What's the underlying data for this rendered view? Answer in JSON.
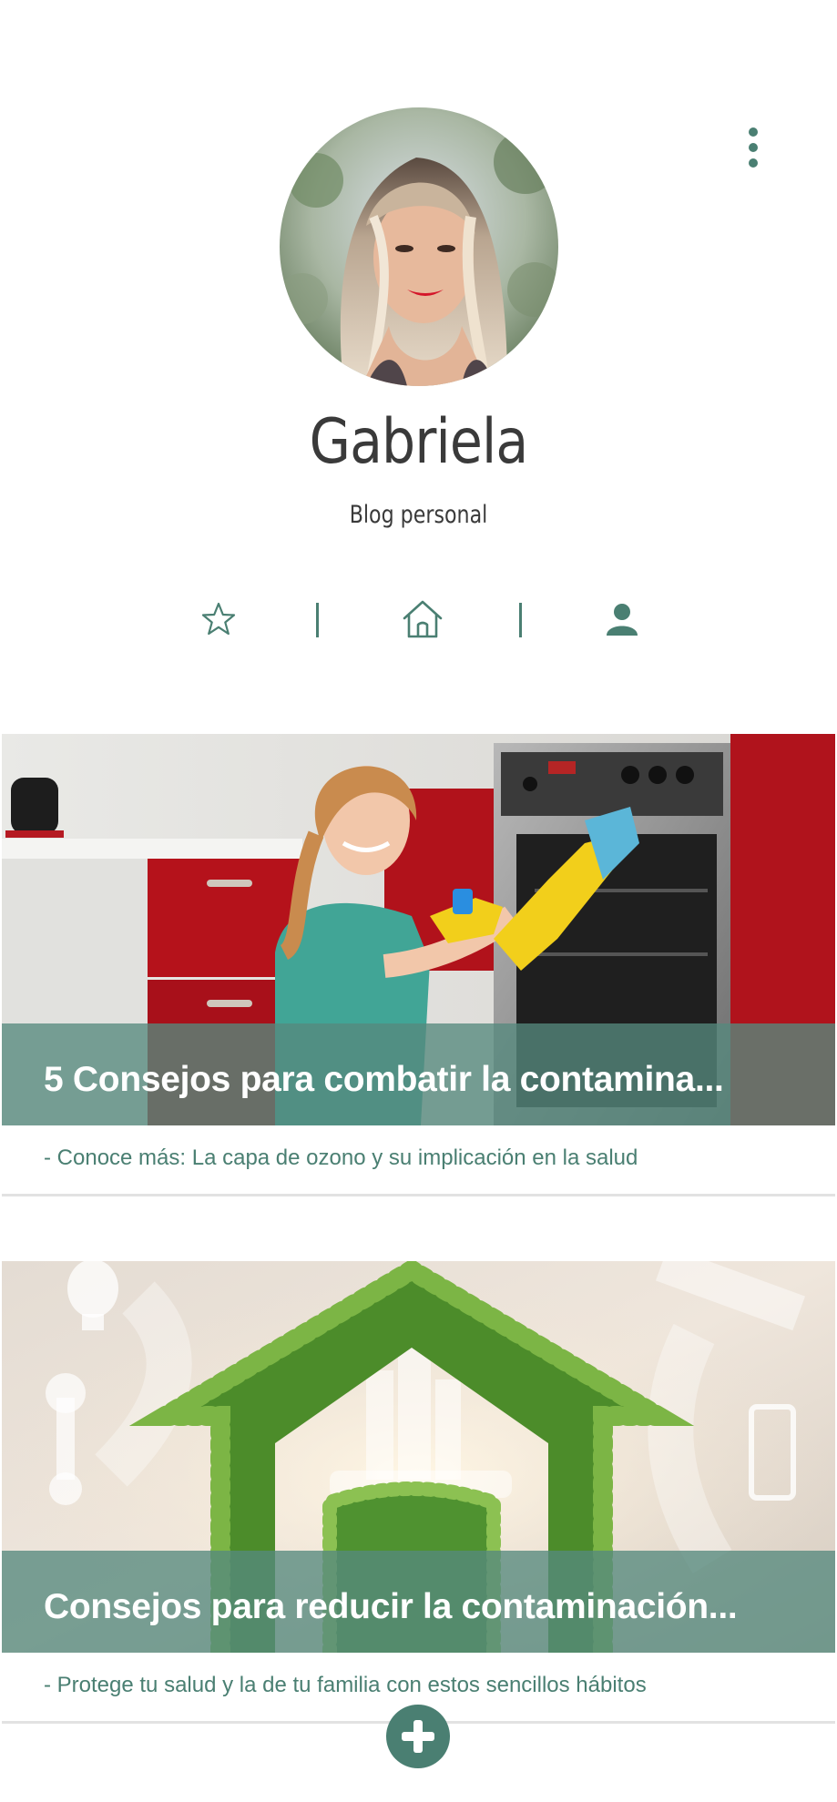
{
  "profile": {
    "name": "Gabriela",
    "subtitle": "Blog personal",
    "avatar_icon": "profile-photo"
  },
  "header": {
    "menu_icon": "more-vertical-icon"
  },
  "nav": {
    "tabs": [
      {
        "name": "favorites",
        "icon": "star-icon",
        "active": false
      },
      {
        "name": "home",
        "icon": "home-icon",
        "active": false
      },
      {
        "name": "profile",
        "icon": "user-icon",
        "active": true
      }
    ]
  },
  "posts": [
    {
      "title": "5 Consejos para combatir la contamina...",
      "summary": "- Conoce más: La capa de ozono y su implicación en la salud",
      "image": "woman-cleaning-oven-photo"
    },
    {
      "title": "Consejos para reducir la contaminación...",
      "summary": "- Protege tu salud y la de tu familia con estos sencillos hábitos",
      "image": "green-house-hedge-photo"
    }
  ],
  "fab": {
    "icon": "plus-icon"
  },
  "colors": {
    "accent": "#4a7f72",
    "overlay": "#56897d",
    "text": "#3a3a3a",
    "divider": "#e2e2e2"
  }
}
